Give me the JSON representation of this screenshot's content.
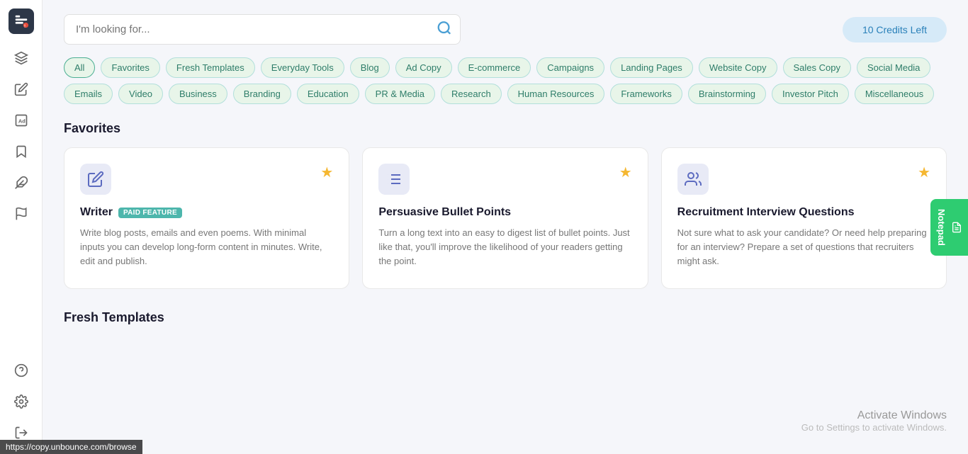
{
  "sidebar": {
    "logo_label": "Logo",
    "icons": [
      {
        "name": "layers-icon",
        "label": "Layers"
      },
      {
        "name": "edit-icon",
        "label": "Edit"
      },
      {
        "name": "ad-icon",
        "label": "Ad"
      },
      {
        "name": "bookmark-icon",
        "label": "Bookmark"
      },
      {
        "name": "puzzle-icon",
        "label": "Puzzle"
      },
      {
        "name": "flag-icon",
        "label": "Flag"
      },
      {
        "name": "help-icon",
        "label": "Help"
      },
      {
        "name": "settings-icon",
        "label": "Settings"
      },
      {
        "name": "logout-icon",
        "label": "Logout"
      }
    ]
  },
  "search": {
    "placeholder": "I'm looking for...",
    "value": ""
  },
  "credits": {
    "label": "10 Credits Left"
  },
  "chips": [
    {
      "id": "all",
      "label": "All"
    },
    {
      "id": "favorites",
      "label": "Favorites"
    },
    {
      "id": "fresh-templates",
      "label": "Fresh Templates"
    },
    {
      "id": "everyday-tools",
      "label": "Everyday Tools"
    },
    {
      "id": "blog",
      "label": "Blog"
    },
    {
      "id": "ad-copy",
      "label": "Ad Copy"
    },
    {
      "id": "e-commerce",
      "label": "E-commerce"
    },
    {
      "id": "campaigns",
      "label": "Campaigns"
    },
    {
      "id": "landing-pages",
      "label": "Landing Pages"
    },
    {
      "id": "website-copy",
      "label": "Website Copy"
    },
    {
      "id": "sales-copy",
      "label": "Sales Copy"
    },
    {
      "id": "social-media",
      "label": "Social Media"
    },
    {
      "id": "emails",
      "label": "Emails"
    },
    {
      "id": "video",
      "label": "Video"
    },
    {
      "id": "business",
      "label": "Business"
    },
    {
      "id": "branding",
      "label": "Branding"
    },
    {
      "id": "education",
      "label": "Education"
    },
    {
      "id": "pr-media",
      "label": "PR & Media"
    },
    {
      "id": "research",
      "label": "Research"
    },
    {
      "id": "human-resources",
      "label": "Human Resources"
    },
    {
      "id": "frameworks",
      "label": "Frameworks"
    },
    {
      "id": "brainstorming",
      "label": "Brainstorming"
    },
    {
      "id": "investor-pitch",
      "label": "Investor Pitch"
    },
    {
      "id": "miscellaneous",
      "label": "Miscellaneous"
    }
  ],
  "favorites_section": {
    "title": "Favorites",
    "cards": [
      {
        "id": "writer",
        "title": "Writer",
        "paid": true,
        "paid_label": "PAID FEATURE",
        "description": "Write blog posts, emails and even poems. With minimal inputs you can develop long-form content in minutes. Write, edit and publish.",
        "starred": true
      },
      {
        "id": "persuasive-bullet-points",
        "title": "Persuasive Bullet Points",
        "paid": false,
        "description": "Turn a long text into an easy to digest list of bullet points. Just like that, you'll improve the likelihood of your readers getting the point.",
        "starred": true
      },
      {
        "id": "recruitment-interview-questions",
        "title": "Recruitment Interview Questions",
        "paid": false,
        "description": "Not sure what to ask your candidate? Or need help preparing for an interview? Prepare a set of questions that recruiters might ask.",
        "starred": true
      }
    ]
  },
  "fresh_templates_section": {
    "title": "Fresh Templates"
  },
  "notepad": {
    "label": "Notepad"
  },
  "status_bar": {
    "url": "https://copy.unbounce.com/browse"
  },
  "windows_activation": {
    "title": "Activate Windows",
    "subtitle": "Go to Settings to activate Windows."
  }
}
